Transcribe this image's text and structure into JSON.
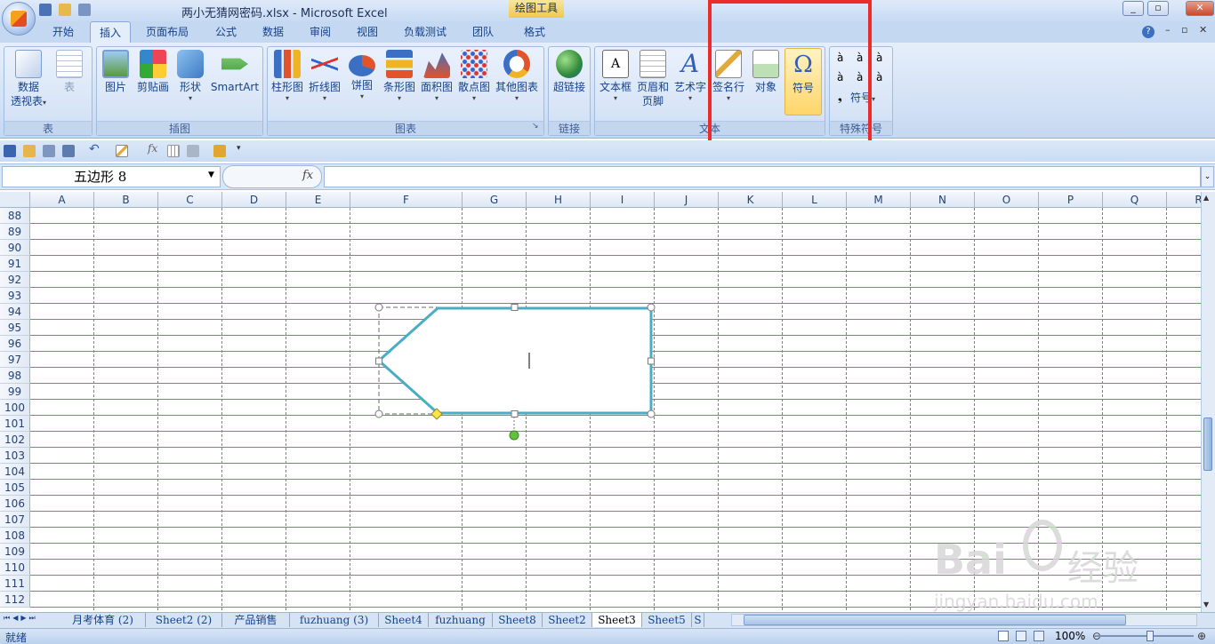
{
  "window": {
    "title": "两小无猜网密码.xlsx - Microsoft Excel",
    "context_tab": "绘图工具"
  },
  "tabs": [
    "开始",
    "插入",
    "页面布局",
    "公式",
    "数据",
    "审阅",
    "视图",
    "负载测试",
    "团队",
    "格式"
  ],
  "ribbon": {
    "groups": [
      {
        "label": "表",
        "buttons": [
          {
            "label": "数据",
            "label2": "透视表",
            "caret": "▾"
          },
          {
            "label": "表"
          }
        ]
      },
      {
        "label": "插图",
        "buttons": [
          {
            "label": "图片"
          },
          {
            "label": "剪贴画"
          },
          {
            "label": "形状",
            "caret": "▾"
          },
          {
            "label": "SmartArt"
          }
        ]
      },
      {
        "label": "图表",
        "buttons": [
          {
            "label": "柱形图"
          },
          {
            "label": "折线图"
          },
          {
            "label": "饼图"
          },
          {
            "label": "条形图"
          },
          {
            "label": "面积图"
          },
          {
            "label": "散点图"
          },
          {
            "label": "其他图表"
          }
        ]
      },
      {
        "label": "链接",
        "buttons": [
          {
            "label": "超链接"
          }
        ]
      },
      {
        "label": "文本",
        "buttons": [
          {
            "label": "文本框"
          },
          {
            "label": "页眉和",
            "label2": "页脚"
          },
          {
            "label": "艺术字"
          },
          {
            "label": "签名行"
          },
          {
            "label": "对象"
          },
          {
            "label": "符号"
          }
        ]
      },
      {
        "label": "特殊符号",
        "buttons": [
          {
            "label": "符号",
            "caret": "▾"
          }
        ]
      }
    ],
    "special_chars": [
      "à",
      "à",
      "à",
      "à",
      "à",
      "à",
      "❟"
    ]
  },
  "namebox": {
    "value": "五边形 8"
  },
  "formula": {
    "fx": "fx",
    "value": ""
  },
  "columns": [
    "A",
    "B",
    "C",
    "D",
    "E",
    "F",
    "G",
    "H",
    "I",
    "J",
    "K",
    "L",
    "M",
    "N",
    "O",
    "P",
    "Q",
    "R"
  ],
  "rows": [
    "88",
    "89",
    "90",
    "91",
    "92",
    "93",
    "94",
    "95",
    "96",
    "97",
    "98",
    "99",
    "100",
    "101",
    "102",
    "103",
    "104",
    "105",
    "106",
    "107",
    "108",
    "109",
    "110",
    "111",
    "112"
  ],
  "sheets": [
    "月考体育 (2)",
    "Sheet2 (2)",
    "产品销售",
    "fuzhuang (3)",
    "Sheet4",
    "fuzhuang",
    "Sheet8",
    "Sheet2",
    "Sheet3",
    "Sheet5",
    "S"
  ],
  "active_sheet": "Sheet3",
  "status": {
    "text": "就绪",
    "zoom": "100%"
  },
  "watermark": {
    "brand": "Bai",
    "brand_cn": "经验",
    "url": "jingyan.baidu.com"
  },
  "colors": {
    "grid": "#c054d0",
    "shape_outline": "#4bacc6",
    "highlight": "#ee2b2b"
  }
}
